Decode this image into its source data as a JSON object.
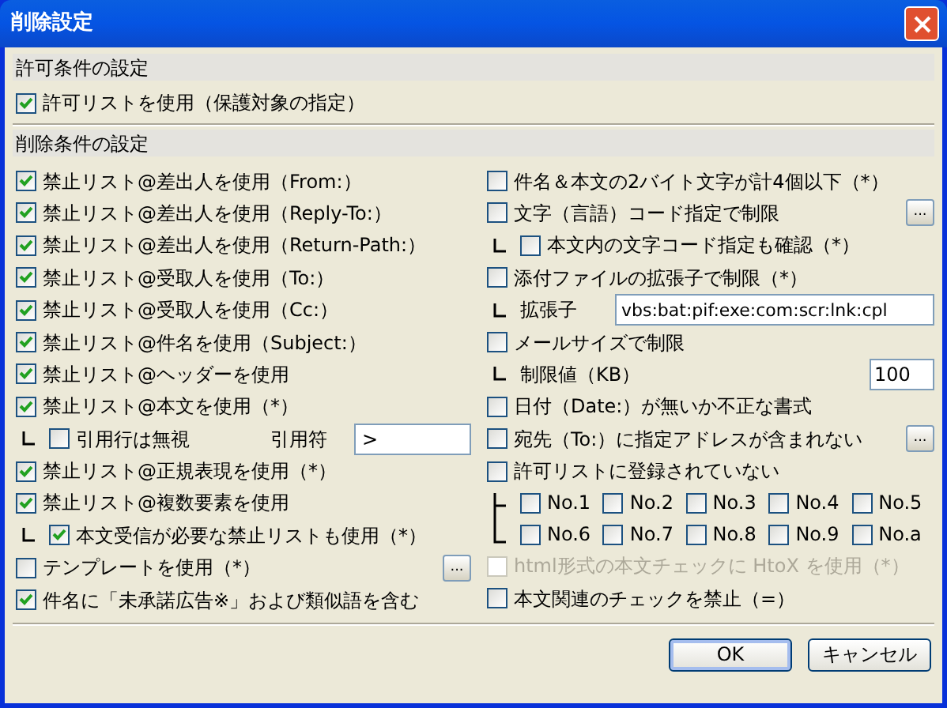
{
  "window": {
    "title": "削除設定"
  },
  "allow_section": {
    "heading": "許可条件の設定",
    "items": [
      {
        "kind": "check",
        "label": "許可リストを使用（保護対象の指定）",
        "checked": true
      }
    ]
  },
  "delete_section": {
    "heading": "削除条件の設定",
    "left": [
      {
        "kind": "check",
        "label": "禁止リスト@差出人を使用（From:）",
        "checked": true
      },
      {
        "kind": "check",
        "label": "禁止リスト@差出人を使用（Reply-To:）",
        "checked": true
      },
      {
        "kind": "check",
        "label": "禁止リスト@差出人を使用（Return-Path:）",
        "checked": true
      },
      {
        "kind": "check",
        "label": "禁止リスト@受取人を使用（To:）",
        "checked": true
      },
      {
        "kind": "check",
        "label": "禁止リスト@受取人を使用（Cc:）",
        "checked": true
      },
      {
        "kind": "check",
        "label": "禁止リスト@件名を使用（Subject:）",
        "checked": true
      },
      {
        "kind": "check",
        "label": "禁止リスト@ヘッダーを使用",
        "checked": true
      },
      {
        "kind": "check",
        "label": "禁止リスト@本文を使用（*）",
        "checked": true
      },
      {
        "kind": "sub_check_field",
        "label": "引用行は無視",
        "checked": false,
        "field_label": "引用符",
        "value": ">"
      },
      {
        "kind": "check",
        "label": "禁止リスト@正規表現を使用（*）",
        "checked": true
      },
      {
        "kind": "check",
        "label": "禁止リスト@複数要素を使用",
        "checked": true
      },
      {
        "kind": "sub_check",
        "label": "本文受信が必要な禁止リストも使用（*）",
        "checked": true
      },
      {
        "kind": "check",
        "label": "テンプレートを使用（*）",
        "checked": false,
        "button": "..."
      },
      {
        "kind": "check",
        "label": "件名に「未承諾広告※」および類似語を含む",
        "checked": true
      }
    ],
    "right": [
      {
        "kind": "check",
        "label": "件名＆本文の2バイト文字が計4個以下（*）",
        "checked": false
      },
      {
        "kind": "check",
        "label": "文字（言語）コード指定で制限",
        "checked": false,
        "button": "..."
      },
      {
        "kind": "sub_check",
        "label": "本文内の文字コード指定も確認（*）",
        "checked": false
      },
      {
        "kind": "check",
        "label": "添付ファイルの拡張子で制限（*）",
        "checked": false
      },
      {
        "kind": "sub_field",
        "label": "拡張子",
        "value": "vbs:bat:pif:exe:com:scr:lnk:cpl"
      },
      {
        "kind": "check",
        "label": "メールサイズで制限",
        "checked": false
      },
      {
        "kind": "sub_field_short",
        "label": "制限値（KB）",
        "value": "100"
      },
      {
        "kind": "check",
        "label": "日付（Date:）が無いか不正な書式",
        "checked": false
      },
      {
        "kind": "check",
        "label": "宛先（To:）に指定アドレスが含まれない",
        "checked": false,
        "button": "..."
      },
      {
        "kind": "check",
        "label": "許可リストに登録されていない",
        "checked": false
      },
      {
        "kind": "grid",
        "items": [
          {
            "label": "No.1",
            "checked": false
          },
          {
            "label": "No.2",
            "checked": false
          },
          {
            "label": "No.3",
            "checked": false
          },
          {
            "label": "No.4",
            "checked": false
          },
          {
            "label": "No.5",
            "checked": false
          },
          {
            "label": "No.6",
            "checked": false
          },
          {
            "label": "No.7",
            "checked": false
          },
          {
            "label": "No.8",
            "checked": false
          },
          {
            "label": "No.9",
            "checked": false
          },
          {
            "label": "No.a",
            "checked": false
          }
        ]
      },
      {
        "kind": "check",
        "label": "html形式の本文チェックに HtoX を使用（*）",
        "checked": false,
        "disabled": true
      },
      {
        "kind": "check",
        "label": "本文関連のチェックを禁止（=）",
        "checked": false
      }
    ]
  },
  "buttons": [
    {
      "label": "OK",
      "default": true
    },
    {
      "label": "キャンセル",
      "default": false
    }
  ]
}
